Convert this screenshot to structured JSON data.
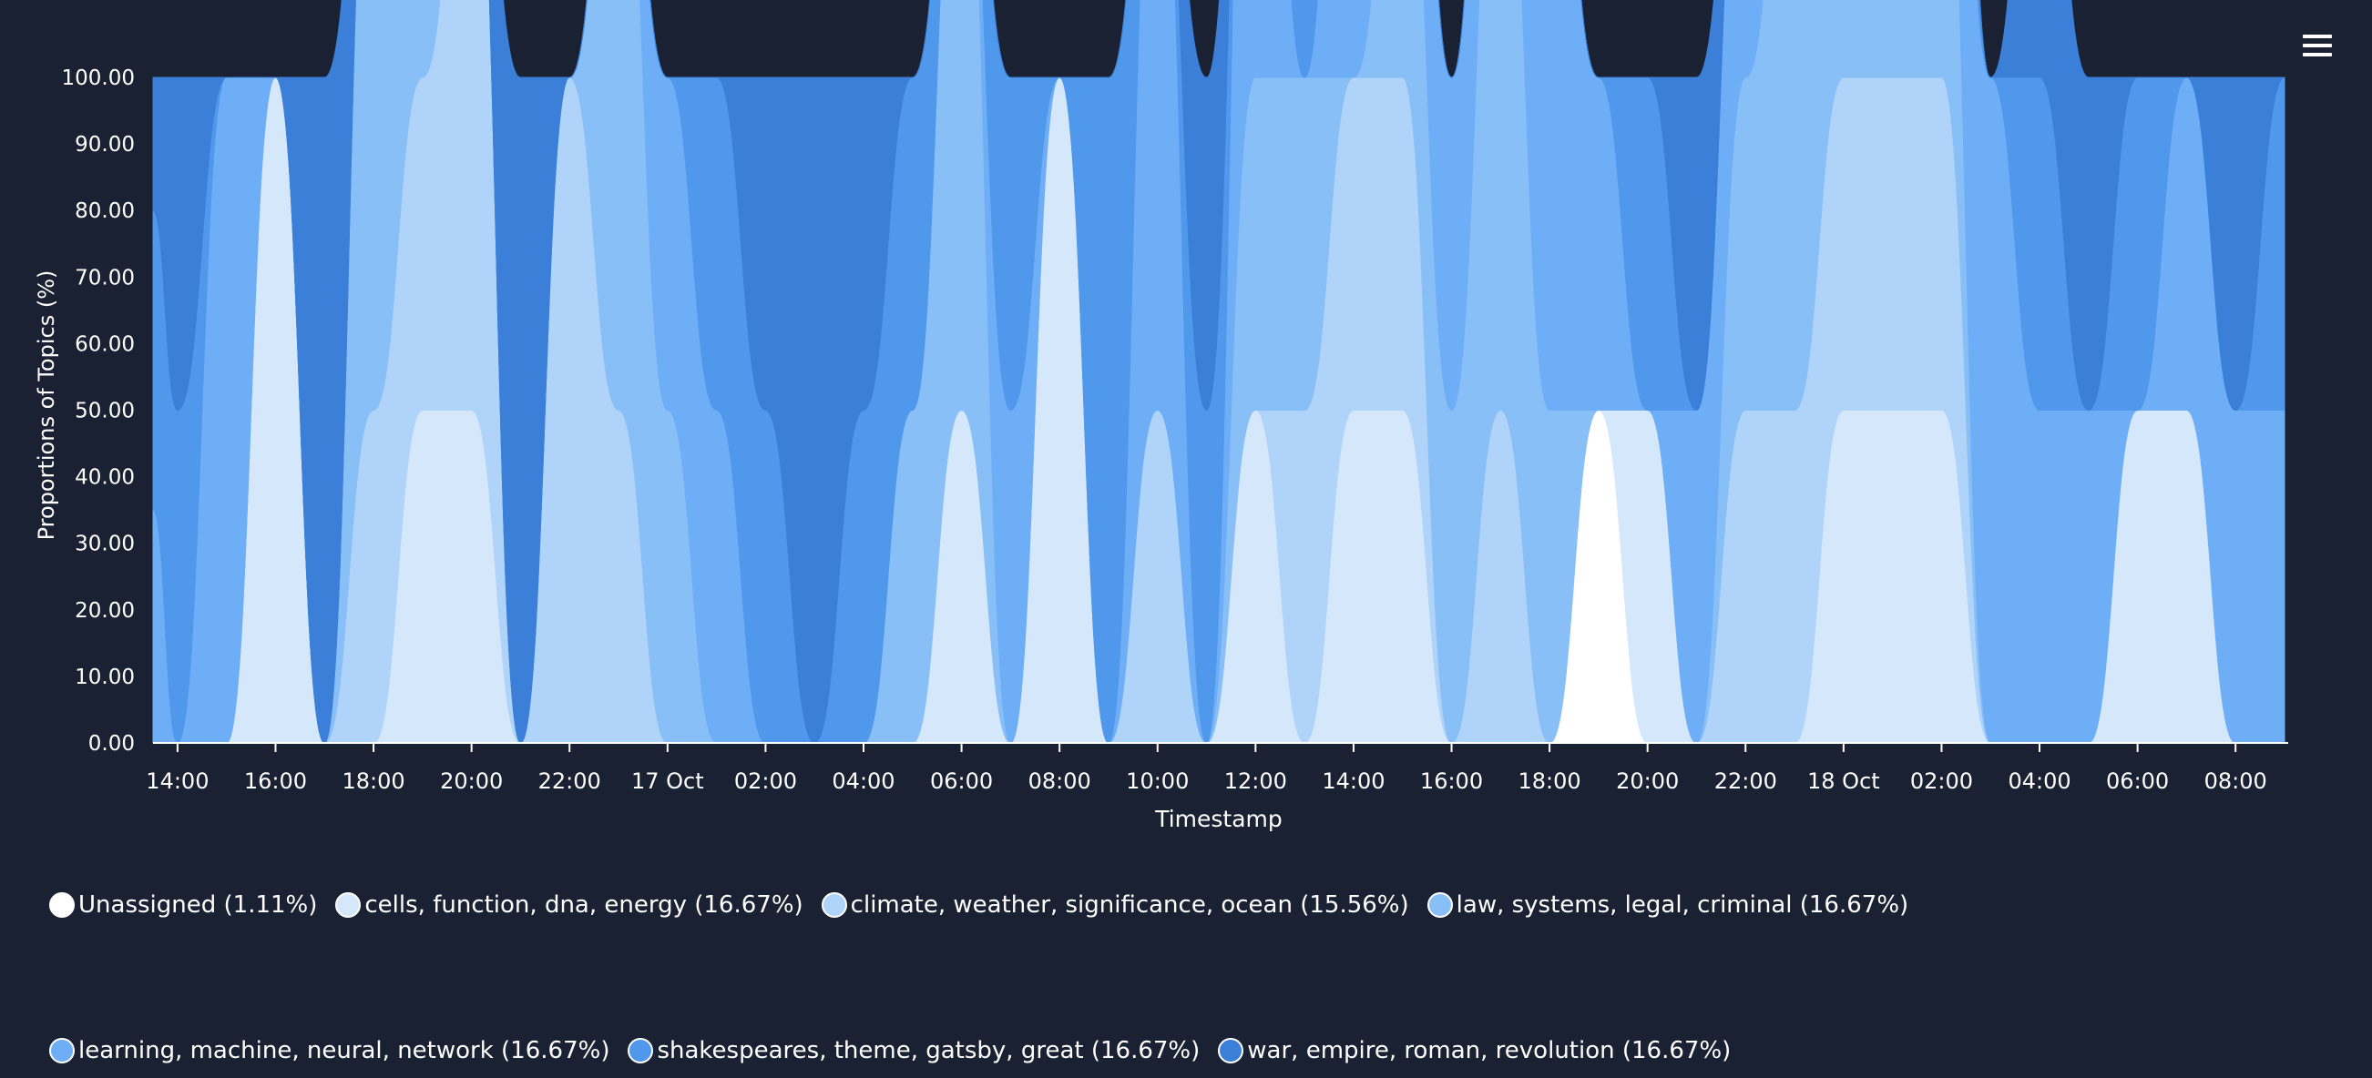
{
  "chart_data": {
    "type": "area",
    "stacked": true,
    "normalized": true,
    "xlabel": "Timestamp",
    "ylabel": "Proportions of Topics (%)",
    "ylim": [
      0,
      100
    ],
    "xlim": [
      "2023-10-16 13:30",
      "2023-10-18 09:00"
    ],
    "yticks": [
      "0.00",
      "10.00",
      "20.00",
      "30.00",
      "40.00",
      "50.00",
      "60.00",
      "70.00",
      "80.00",
      "90.00",
      "100.00"
    ],
    "xticks": [
      {
        "t": "2023-10-16 14:00",
        "label": "14:00"
      },
      {
        "t": "2023-10-16 16:00",
        "label": "16:00"
      },
      {
        "t": "2023-10-16 18:00",
        "label": "18:00"
      },
      {
        "t": "2023-10-16 20:00",
        "label": "20:00"
      },
      {
        "t": "2023-10-16 22:00",
        "label": "22:00"
      },
      {
        "t": "2023-10-17 00:00",
        "label": "17 Oct"
      },
      {
        "t": "2023-10-17 02:00",
        "label": "02:00"
      },
      {
        "t": "2023-10-17 04:00",
        "label": "04:00"
      },
      {
        "t": "2023-10-17 06:00",
        "label": "06:00"
      },
      {
        "t": "2023-10-17 08:00",
        "label": "08:00"
      },
      {
        "t": "2023-10-17 10:00",
        "label": "10:00"
      },
      {
        "t": "2023-10-17 12:00",
        "label": "12:00"
      },
      {
        "t": "2023-10-17 14:00",
        "label": "14:00"
      },
      {
        "t": "2023-10-17 16:00",
        "label": "16:00"
      },
      {
        "t": "2023-10-17 18:00",
        "label": "18:00"
      },
      {
        "t": "2023-10-17 20:00",
        "label": "20:00"
      },
      {
        "t": "2023-10-17 22:00",
        "label": "22:00"
      },
      {
        "t": "2023-10-18 00:00",
        "label": "18 Oct"
      },
      {
        "t": "2023-10-18 02:00",
        "label": "02:00"
      },
      {
        "t": "2023-10-18 04:00",
        "label": "04:00"
      },
      {
        "t": "2023-10-18 06:00",
        "label": "06:00"
      },
      {
        "t": "2023-10-18 08:00",
        "label": "08:00"
      }
    ],
    "x": [
      "2023-10-16 13:30",
      "2023-10-16 14:00",
      "2023-10-16 15:00",
      "2023-10-16 16:00",
      "2023-10-16 17:00",
      "2023-10-16 18:00",
      "2023-10-16 19:00",
      "2023-10-16 20:00",
      "2023-10-16 21:00",
      "2023-10-16 22:00",
      "2023-10-16 23:00",
      "2023-10-17 00:00",
      "2023-10-17 01:00",
      "2023-10-17 02:00",
      "2023-10-17 03:00",
      "2023-10-17 04:00",
      "2023-10-17 05:00",
      "2023-10-17 06:00",
      "2023-10-17 07:00",
      "2023-10-17 08:00",
      "2023-10-17 09:00",
      "2023-10-17 10:00",
      "2023-10-17 11:00",
      "2023-10-17 12:00",
      "2023-10-17 13:00",
      "2023-10-17 14:00",
      "2023-10-17 15:00",
      "2023-10-17 16:00",
      "2023-10-17 17:00",
      "2023-10-17 18:00",
      "2023-10-17 19:00",
      "2023-10-17 20:00",
      "2023-10-17 21:00",
      "2023-10-17 22:00",
      "2023-10-17 23:00",
      "2023-10-18 00:00",
      "2023-10-18 01:00",
      "2023-10-18 02:00",
      "2023-10-18 03:00",
      "2023-10-18 04:00",
      "2023-10-18 05:00",
      "2023-10-18 06:00",
      "2023-10-18 07:00",
      "2023-10-18 08:00",
      "2023-10-18 09:00"
    ],
    "series": [
      {
        "name": "Unassigned (1.11%)",
        "color": "#ffffff",
        "values": [
          0,
          0,
          0,
          0,
          0,
          0,
          0,
          0,
          0,
          0,
          0,
          0,
          0,
          0,
          0,
          0,
          0,
          0,
          0,
          0,
          0,
          0,
          0,
          0,
          0,
          0,
          0,
          0,
          0,
          0,
          50,
          0,
          0,
          0,
          0,
          0,
          0,
          0,
          0,
          0,
          0,
          0,
          0,
          0,
          0
        ]
      },
      {
        "name": "cells, function, dna, energy (16.67%)",
        "color": "#d5e8fb",
        "values": [
          0,
          0,
          0,
          100,
          0,
          0,
          50,
          50,
          0,
          0,
          0,
          0,
          0,
          0,
          0,
          0,
          0,
          50,
          0,
          100,
          0,
          0,
          0,
          50,
          0,
          50,
          50,
          0,
          0,
          0,
          0,
          50,
          0,
          0,
          0,
          50,
          50,
          50,
          0,
          0,
          0,
          50,
          50,
          0,
          0
        ]
      },
      {
        "name": "climate, weather, significance, ocean (15.56%)",
        "color": "#afd3f9",
        "values": [
          0,
          0,
          0,
          0,
          0,
          50,
          50,
          100,
          0,
          100,
          50,
          0,
          0,
          0,
          0,
          0,
          0,
          0,
          0,
          0,
          0,
          50,
          0,
          0,
          50,
          50,
          50,
          0,
          50,
          0,
          0,
          0,
          0,
          50,
          50,
          50,
          50,
          50,
          0,
          0,
          0,
          0,
          0,
          0,
          0
        ]
      },
      {
        "name": "law, systems, legal, criminal (16.67%)",
        "color": "#88bff7",
        "values": [
          0,
          0,
          0,
          0,
          0,
          100,
          50,
          0,
          0,
          0,
          100,
          50,
          0,
          0,
          0,
          0,
          50,
          100,
          0,
          0,
          0,
          0,
          0,
          50,
          50,
          0,
          50,
          50,
          100,
          50,
          0,
          0,
          0,
          50,
          100,
          100,
          100,
          50,
          0,
          0,
          0,
          0,
          0,
          0,
          0
        ]
      },
      {
        "name": "learning, machine, neural, network (16.67%)",
        "color": "#6eaef6",
        "values": [
          35,
          0,
          100,
          0,
          0,
          0,
          0,
          0,
          0,
          0,
          0,
          50,
          50,
          0,
          0,
          0,
          0,
          0,
          50,
          0,
          0,
          100,
          0,
          100,
          0,
          100,
          50,
          50,
          50,
          100,
          50,
          0,
          50,
          50,
          50,
          50,
          50,
          50,
          100,
          50,
          50,
          0,
          50,
          50,
          50
        ]
      },
      {
        "name": "shakespeares, theme, gatsby, great (16.67%)",
        "color": "#4f98eb",
        "values": [
          45,
          50,
          0,
          0,
          0,
          0,
          0,
          0,
          0,
          0,
          0,
          0,
          50,
          50,
          0,
          50,
          50,
          0,
          50,
          0,
          100,
          0,
          50,
          0,
          50,
          0,
          0,
          0,
          0,
          0,
          0,
          50,
          0,
          0,
          0,
          0,
          0,
          50,
          0,
          50,
          0,
          50,
          0,
          0,
          50
        ]
      },
      {
        "name": "war, empire, roman, revolution (16.67%)",
        "color": "#3b7fd8",
        "values": [
          20,
          50,
          0,
          0,
          100,
          0,
          0,
          0,
          100,
          0,
          0,
          0,
          0,
          50,
          100,
          50,
          0,
          0,
          0,
          0,
          0,
          0,
          50,
          0,
          0,
          0,
          0,
          0,
          0,
          0,
          0,
          0,
          50,
          0,
          0,
          0,
          0,
          0,
          0,
          50,
          50,
          0,
          0,
          50,
          0
        ]
      }
    ],
    "legend_position": "bottom",
    "grid": false
  },
  "menu": {
    "icon": "hamburger-menu-icon"
  }
}
